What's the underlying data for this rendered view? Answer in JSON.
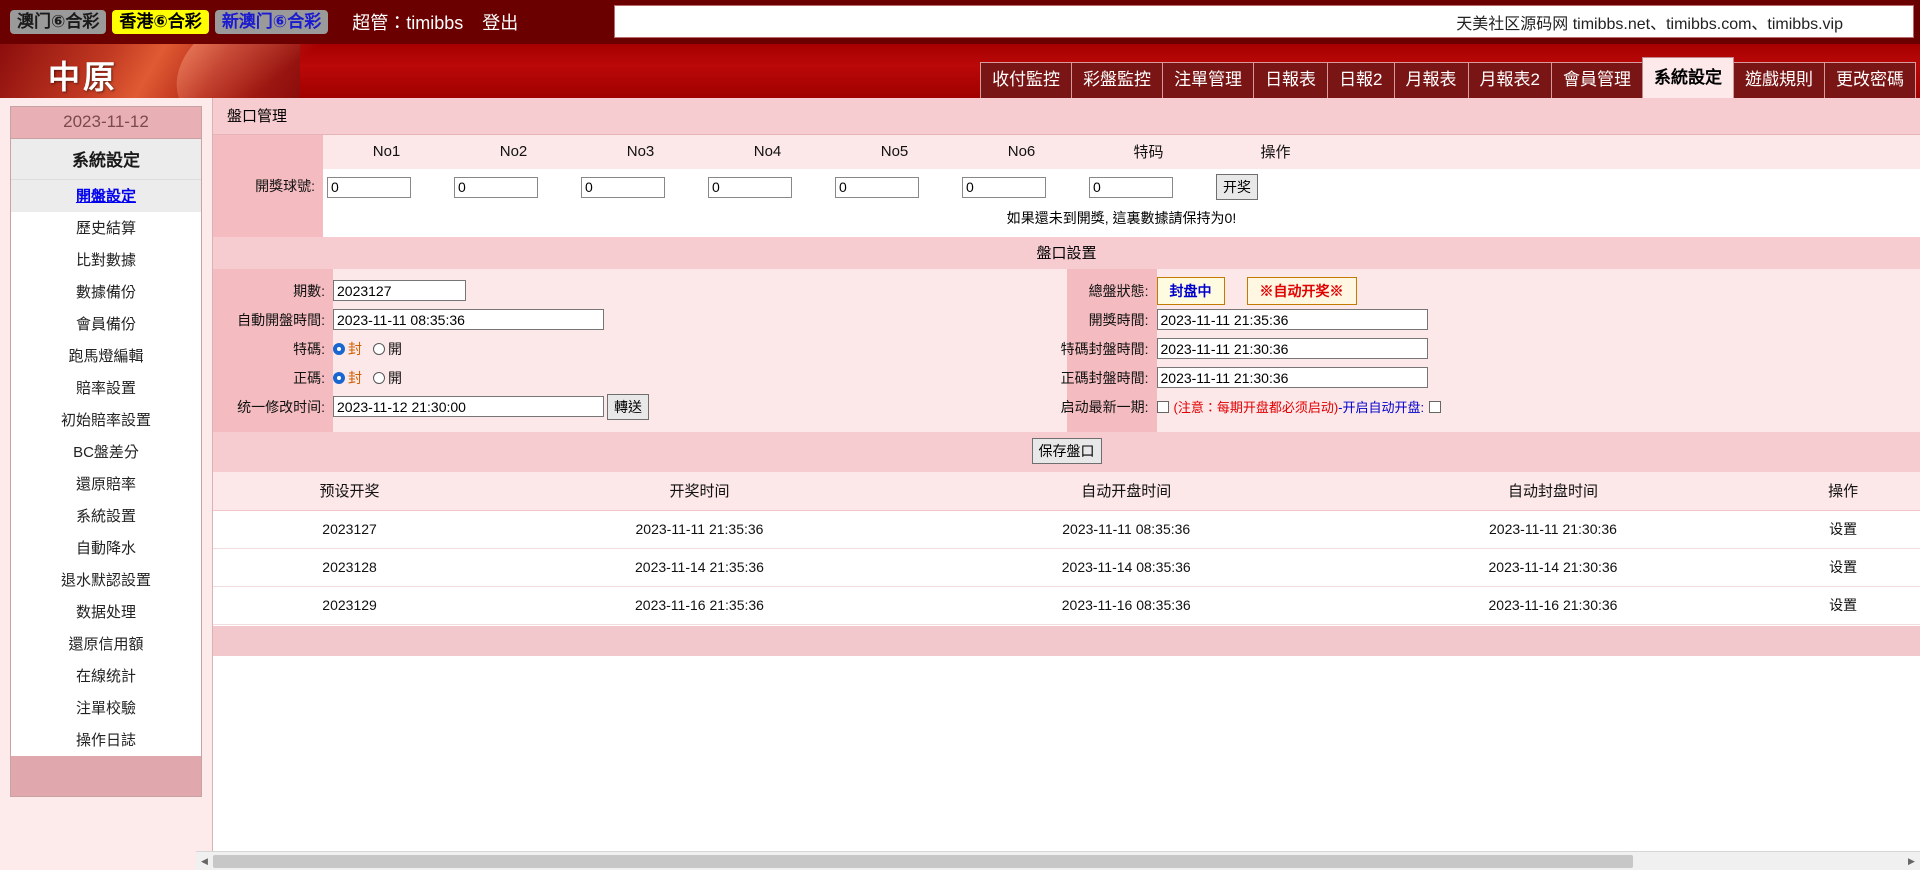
{
  "topbar": {
    "game_tabs": [
      {
        "label": "澳门⑥合彩",
        "style": "gray"
      },
      {
        "label": "香港⑥合彩",
        "style": "yellow"
      },
      {
        "label": "新澳门⑥合彩",
        "style": "blue"
      }
    ],
    "admin_label": "超管：timibbs",
    "logout_label": "登出",
    "notice": "天美社区源码网 timibbs.net、timibbs.com、timibbs.vip"
  },
  "header": {
    "logo": "中原",
    "nav": [
      {
        "label": "收付監控",
        "active": false
      },
      {
        "label": "彩盤監控",
        "active": false
      },
      {
        "label": "注單管理",
        "active": false
      },
      {
        "label": "日報表",
        "active": false
      },
      {
        "label": "日報2",
        "active": false
      },
      {
        "label": "月報表",
        "active": false
      },
      {
        "label": "月報表2",
        "active": false
      },
      {
        "label": "會員管理",
        "active": false
      },
      {
        "label": "系統設定",
        "active": true
      },
      {
        "label": "遊戲規則",
        "active": false
      },
      {
        "label": "更改密碼",
        "active": false
      }
    ]
  },
  "sidebar": {
    "date": "2023-11-12",
    "title": "系統設定",
    "items": [
      {
        "label": "開盤設定",
        "active": true
      },
      {
        "label": "歷史結算",
        "active": false
      },
      {
        "label": "比對數據",
        "active": false
      },
      {
        "label": "數據備份",
        "active": false
      },
      {
        "label": "會員備份",
        "active": false
      },
      {
        "label": "跑馬燈編輯",
        "active": false
      },
      {
        "label": "賠率設置",
        "active": false
      },
      {
        "label": "初始賠率設置",
        "active": false
      },
      {
        "label": "BC盤差分",
        "active": false
      },
      {
        "label": "還原賠率",
        "active": false
      },
      {
        "label": "系統設置",
        "active": false
      },
      {
        "label": "自動降水",
        "active": false
      },
      {
        "label": "退水默認設置",
        "active": false
      },
      {
        "label": "数据处理",
        "active": false
      },
      {
        "label": "還原信用額",
        "active": false
      },
      {
        "label": "在線统計",
        "active": false
      },
      {
        "label": "注單校驗",
        "active": false
      },
      {
        "label": "操作日誌",
        "active": false
      }
    ]
  },
  "main": {
    "panel_title": "盤口管理",
    "draw": {
      "row_label": "開獎球號:",
      "columns": [
        "No1",
        "No2",
        "No3",
        "No4",
        "No5",
        "No6",
        "特码",
        "操作"
      ],
      "values": [
        "0",
        "0",
        "0",
        "0",
        "0",
        "0",
        "0"
      ],
      "action_label": "开奖",
      "hint": "如果還未到開獎, 這裏數據請保持为0!"
    },
    "settings": {
      "band_title": "盤口設置",
      "left": {
        "period_label": "期數:",
        "period_value": "2023127",
        "auto_open_label": "自動開盤時間:",
        "auto_open_value": "2023-11-11 08:35:36",
        "special_label": "特碼:",
        "special_closed": "封",
        "special_open": "開",
        "special_selected": "封",
        "normal_label": "正碼:",
        "normal_closed": "封",
        "normal_open": "開",
        "normal_selected": "封",
        "unified_label": "统一修改时间:",
        "unified_value": "2023-11-12 21:30:00",
        "transfer_btn": "轉送"
      },
      "right": {
        "state_label": "總盤狀態:",
        "state_value": "封盘中",
        "auto_draw_btn": "※自动开奖※",
        "draw_time_label": "開獎時間:",
        "draw_time_value": "2023-11-11 21:35:36",
        "special_close_label": "特碼封盤時間:",
        "special_close_value": "2023-11-11 21:30:36",
        "normal_close_label": "正碼封盤時間:",
        "normal_close_value": "2023-11-11 21:30:36",
        "start_latest_label": "启动最新一期:",
        "start_latest_checked": false,
        "note": "(注意：每期开盘都必须启动)",
        "auto_open_toggle_label": "-开启自动开盘:",
        "auto_open_toggle_checked": false
      },
      "save_btn": "保存盤口"
    },
    "results": {
      "columns": [
        "预设开奖",
        "开奖时间",
        "自动开盘时间",
        "自动封盘时间",
        "操作"
      ],
      "rows": [
        {
          "period": "2023127",
          "draw_time": "2023-11-11 21:35:36",
          "auto_open": "2023-11-11 08:35:36",
          "auto_close": "2023-11-11 21:30:36",
          "action": "设置"
        },
        {
          "period": "2023128",
          "draw_time": "2023-11-14 21:35:36",
          "auto_open": "2023-11-14 08:35:36",
          "auto_close": "2023-11-14 21:30:36",
          "action": "设置"
        },
        {
          "period": "2023129",
          "draw_time": "2023-11-16 21:35:36",
          "auto_open": "2023-11-16 08:35:36",
          "auto_close": "2023-11-16 21:30:36",
          "action": "设置"
        }
      ]
    }
  },
  "scrollbar": {
    "left_arrow": "◀",
    "right_arrow": "▶"
  },
  "colors": {
    "dark_red": "#6b0000",
    "brand_red": "#b00000",
    "pink_band": "#f6ccd0",
    "pink_light": "#fce7e9",
    "link_blue": "#0000ee",
    "alert_red": "#e00000"
  }
}
